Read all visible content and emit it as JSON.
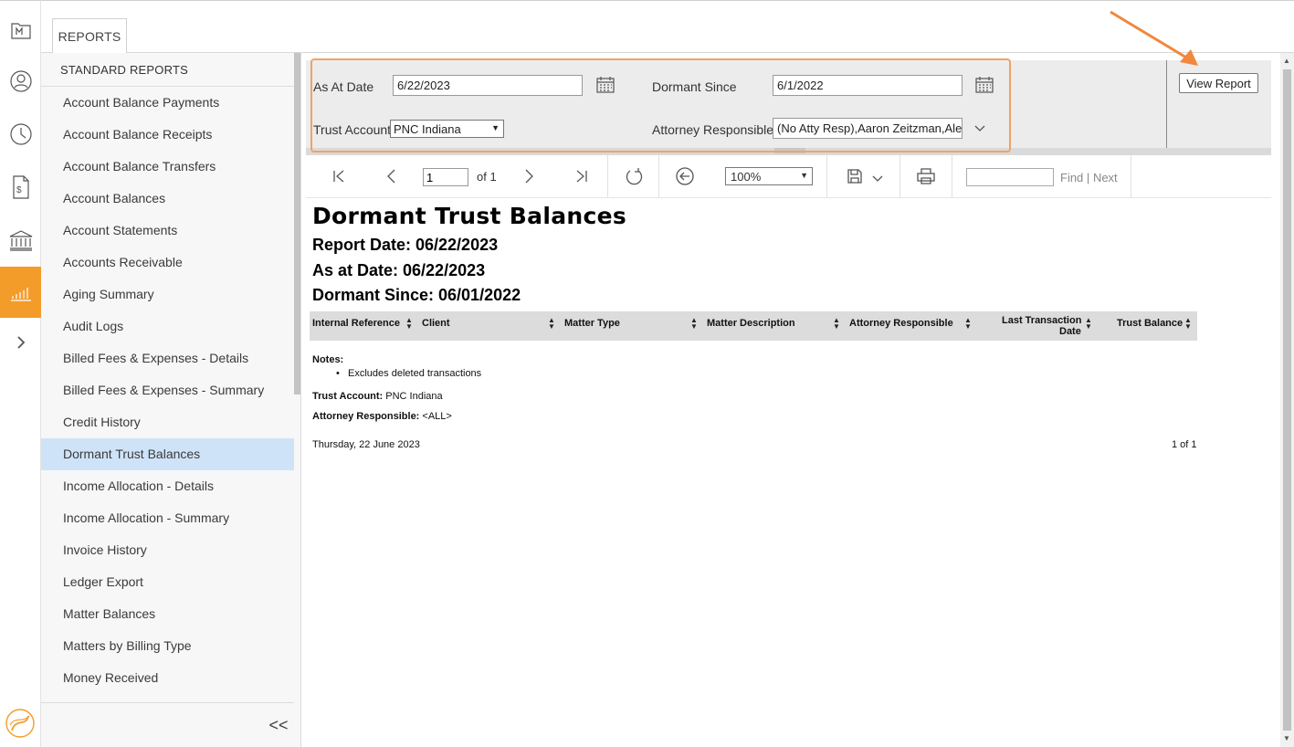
{
  "rail": {
    "items": [
      {
        "name": "matters-icon"
      },
      {
        "name": "contacts-icon"
      },
      {
        "name": "time-icon"
      },
      {
        "name": "billing-icon"
      },
      {
        "name": "trust-bank-icon"
      },
      {
        "name": "reports-icon",
        "active": true
      },
      {
        "name": "expand-icon"
      }
    ]
  },
  "tabs": {
    "reports": "REPORTS"
  },
  "sidebar": {
    "header": "STANDARD REPORTS",
    "items": [
      "Account Balance Payments",
      "Account Balance Receipts",
      "Account Balance Transfers",
      "Account Balances",
      "Account Statements",
      "Accounts Receivable",
      "Aging Summary",
      "Audit Logs",
      "Billed Fees & Expenses - Details",
      "Billed Fees & Expenses - Summary",
      "Credit History",
      "Dormant Trust Balances",
      "Income Allocation - Details",
      "Income Allocation - Summary",
      "Invoice History",
      "Ledger Export",
      "Matter Balances",
      "Matters by Billing Type",
      "Money Received"
    ],
    "selected": "Dormant Trust Balances",
    "collapse": "<<"
  },
  "params": {
    "as_at_label": "As At Date",
    "as_at_value": "6/22/2023",
    "dormant_label": "Dormant Since",
    "dormant_value": "6/1/2022",
    "trust_label": "Trust Account",
    "trust_value": "PNC Indiana",
    "attorney_label": "Attorney Responsible",
    "attorney_value": "(No Atty Resp),Aaron Zeitzman,Ale",
    "view_report": "View Report"
  },
  "toolbar": {
    "page": "1",
    "of": "of 1",
    "zoom": "100%",
    "find": "Find",
    "sep": "|",
    "next": "Next"
  },
  "report": {
    "title": "Dormant Trust Balances",
    "report_date": "Report Date: 06/22/2023",
    "as_at": "As at Date: 06/22/2023",
    "dormant_since": "Dormant Since: 06/01/2022",
    "columns": [
      "Internal Reference",
      "Client",
      "Matter Type",
      "Matter Description",
      "Attorney Responsible",
      "Last Transaction",
      "Date",
      "Trust Balance"
    ],
    "notes_label": "Notes:",
    "notes_item": "Excludes deleted transactions",
    "trust_account_label": "Trust Account:",
    "trust_account_value": "PNC Indiana",
    "attorney_label": "Attorney Responsible:",
    "attorney_value": "<ALL>",
    "footer_date": "Thursday, 22 June 2023",
    "footer_pages": "1 of 1"
  },
  "colors": {
    "accent": "#f39c2a",
    "selected": "#cfe3f8",
    "annotation": "#f0a366"
  }
}
